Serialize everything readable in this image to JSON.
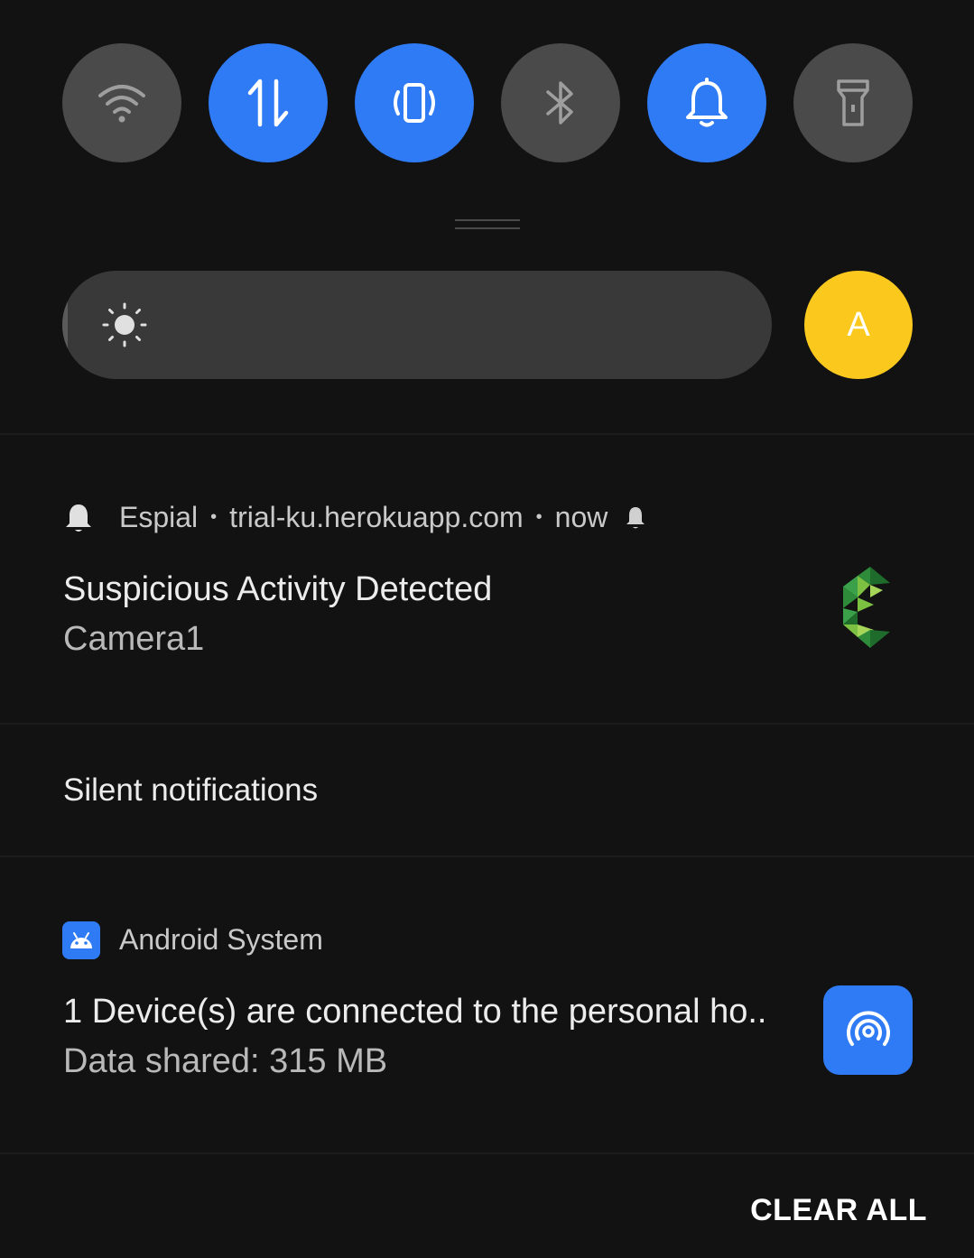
{
  "quick_settings": {
    "tiles": [
      {
        "icon": "wifi-icon",
        "state": "off"
      },
      {
        "icon": "mobile-data-icon",
        "state": "on"
      },
      {
        "icon": "vibrate-icon",
        "state": "on"
      },
      {
        "icon": "bluetooth-icon",
        "state": "off"
      },
      {
        "icon": "bell-icon",
        "state": "on"
      },
      {
        "icon": "flashlight-icon",
        "state": "off"
      }
    ],
    "colors": {
      "on": "#2f7bf5",
      "off": "#4a4a4a"
    },
    "brightness_level_percent": 1
  },
  "user": {
    "avatar_letter": "A",
    "avatar_color": "#fbc91e"
  },
  "notification_1": {
    "app_name": "Espial",
    "source": "trial-ku.herokuapp.com",
    "time": "now",
    "title": "Suspicious Activity Detected",
    "text": "Camera1",
    "separator": "•"
  },
  "silent_section": {
    "header": "Silent notifications"
  },
  "notification_2": {
    "app_name": "Android System",
    "title": "1 Device(s) are connected to the personal ho..",
    "text": "Data shared: 315 MB"
  },
  "actions": {
    "clear_all": "CLEAR ALL"
  }
}
